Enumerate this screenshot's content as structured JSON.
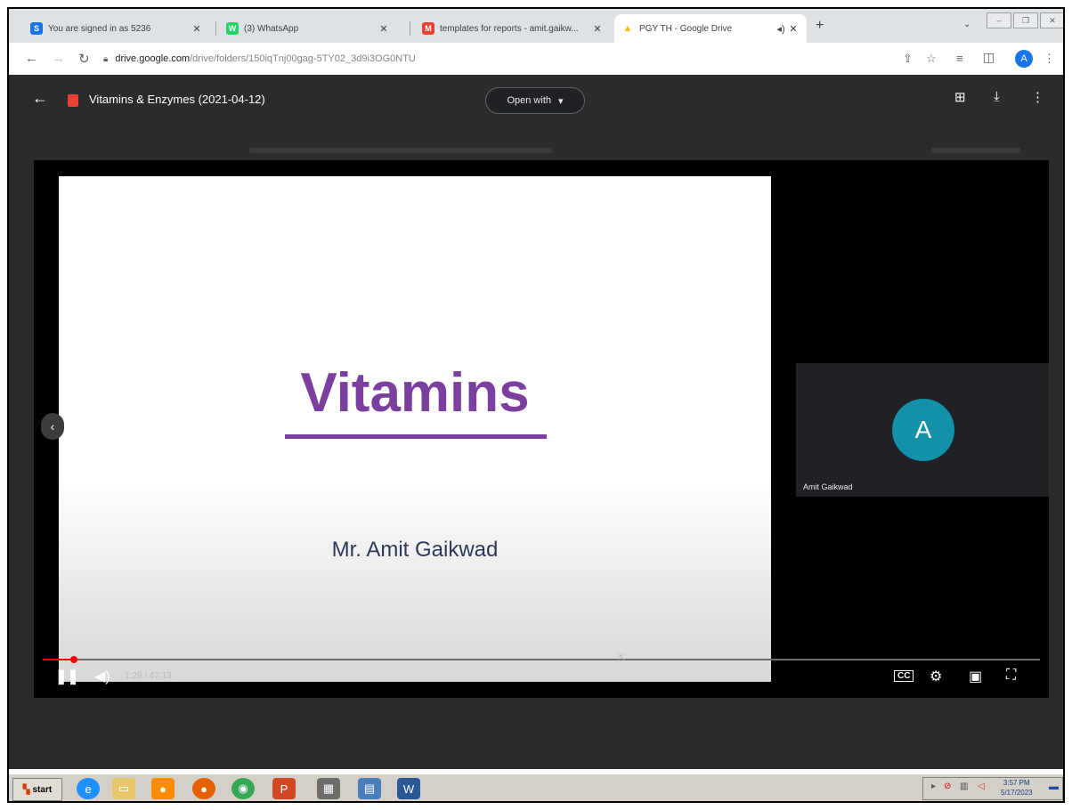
{
  "browser": {
    "tabs": [
      {
        "title": "You are signed in as 5236",
        "favicon": "S",
        "color": "#1a73e8"
      },
      {
        "title": "(3) WhatsApp",
        "favicon": "W",
        "color": "#25d366"
      },
      {
        "title": "templates for reports - amit.gaikw...",
        "favicon": "M",
        "color": "#ea4335"
      },
      {
        "title": "PGY TH - Google Drive",
        "favicon": "▲",
        "color": "#fbbc04"
      }
    ],
    "url_host": "drive.google.com",
    "url_path": "/drive/folders/150iqTnj00gag-5TY02_3d9i3OG0NTU",
    "profile_initial": "A"
  },
  "viewer": {
    "file_title": "Vitamins & Enzymes (2021-04-12)",
    "open_with_label": "Open with",
    "slide_title": "Vitamins",
    "slide_author": "Mr. Amit Gaikwad",
    "participant_initial": "A",
    "participant_name": "Amit Gaikwad",
    "time_display": "1:29 / 47:13",
    "progress_fraction": 0.031
  },
  "taskbar": {
    "start_label": "start",
    "clock_time": "3:57 PM",
    "clock_date": "5/17/2023"
  },
  "icons": [
    "back-icon",
    "forward-icon",
    "reload-icon",
    "lock-icon",
    "share-icon",
    "star-icon",
    "reading-list-icon",
    "sidepanel-icon",
    "menu-icon",
    "add-comment-icon",
    "download-icon",
    "more-icon",
    "play-pause-icon",
    "volume-icon",
    "captions-icon",
    "settings-icon",
    "miniplayer-icon",
    "fullscreen-icon",
    "chevron-left-icon"
  ]
}
